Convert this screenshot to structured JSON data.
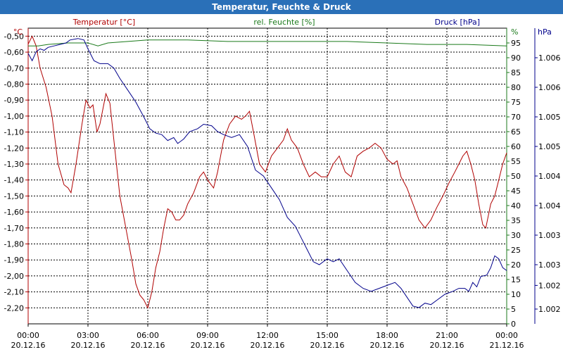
{
  "window": {
    "title": "Temperatur, Feuchte & Druck"
  },
  "chart_data": {
    "type": "line",
    "title": "Temperatur, Feuchte & Druck",
    "grid": true,
    "x": {
      "range_hours": [
        0,
        24
      ],
      "ticks_hours": [
        0,
        3,
        6,
        9,
        12,
        15,
        18,
        21,
        24
      ],
      "time_labels": [
        "00:00",
        "03:00",
        "06:00",
        "09:00",
        "12:00",
        "15:00",
        "18:00",
        "21:00",
        "00:00"
      ],
      "date_labels": [
        "20.12.16",
        "20.12.16",
        "20.12.16",
        "20.12.16",
        "20.12.16",
        "20.12.16",
        "20.12.16",
        "20.12.16",
        "21.12.16"
      ]
    },
    "y_left": {
      "unit_label": "°C",
      "range": [
        -2.3,
        -0.45
      ],
      "ticks": [
        -0.5,
        -0.6,
        -0.7,
        -0.8,
        -0.9,
        -1.0,
        -1.1,
        -1.2,
        -1.3,
        -1.4,
        -1.5,
        -1.6,
        -1.7,
        -1.8,
        -1.9,
        -2.0,
        -2.1,
        -2.2
      ],
      "tick_labels": [
        "-0,50",
        "-0,60",
        "-0,70",
        "-0,80",
        "-0,90",
        "-1,00",
        "-1,10",
        "-1,20",
        "-1,30",
        "-1,40",
        "-1,50",
        "-1,60",
        "-1,70",
        "-1,80",
        "-1,90",
        "-2,00",
        "-2,10",
        "-2,20"
      ]
    },
    "y_mid": {
      "unit_label": "%",
      "range": [
        0,
        100
      ],
      "ticks": [
        0,
        5,
        10,
        15,
        20,
        25,
        30,
        35,
        40,
        45,
        50,
        55,
        60,
        65,
        70,
        75,
        80,
        85,
        90,
        95
      ],
      "tick_labels": [
        "0",
        "5",
        "10",
        "15",
        "20",
        "25",
        "30",
        "35",
        "40",
        "45",
        "50",
        "55",
        "60",
        "65",
        "70",
        "75",
        "80",
        "85",
        "90",
        "95"
      ]
    },
    "y_right": {
      "unit_label": "hPa",
      "tick_labels": [
        "1.006",
        "1.006",
        "1.005",
        "1.005",
        "1.004",
        "1.004",
        "1.003",
        "1.003",
        "1.002",
        "1.002"
      ],
      "tick_humidity_equiv": [
        90,
        80,
        70,
        60,
        50,
        40,
        30,
        20,
        13,
        5
      ]
    },
    "series": [
      {
        "name": "Temperatur [°C]",
        "color": "#b00000",
        "axis": "left",
        "points": [
          [
            0.0,
            -0.55
          ],
          [
            0.2,
            -0.5
          ],
          [
            0.4,
            -0.56
          ],
          [
            0.6,
            -0.7
          ],
          [
            0.9,
            -0.82
          ],
          [
            1.2,
            -1.0
          ],
          [
            1.5,
            -1.3
          ],
          [
            1.8,
            -1.43
          ],
          [
            2.0,
            -1.45
          ],
          [
            2.15,
            -1.48
          ],
          [
            2.4,
            -1.3
          ],
          [
            2.7,
            -1.05
          ],
          [
            2.9,
            -0.9
          ],
          [
            3.1,
            -0.95
          ],
          [
            3.25,
            -0.93
          ],
          [
            3.45,
            -1.1
          ],
          [
            3.6,
            -1.05
          ],
          [
            3.9,
            -0.86
          ],
          [
            4.1,
            -0.92
          ],
          [
            4.3,
            -1.15
          ],
          [
            4.6,
            -1.5
          ],
          [
            4.9,
            -1.7
          ],
          [
            5.2,
            -1.9
          ],
          [
            5.4,
            -2.05
          ],
          [
            5.6,
            -2.12
          ],
          [
            5.8,
            -2.15
          ],
          [
            6.0,
            -2.2
          ],
          [
            6.2,
            -2.1
          ],
          [
            6.4,
            -1.95
          ],
          [
            6.6,
            -1.85
          ],
          [
            6.8,
            -1.7
          ],
          [
            7.0,
            -1.58
          ],
          [
            7.2,
            -1.6
          ],
          [
            7.4,
            -1.65
          ],
          [
            7.6,
            -1.65
          ],
          [
            7.8,
            -1.62
          ],
          [
            8.0,
            -1.55
          ],
          [
            8.3,
            -1.48
          ],
          [
            8.6,
            -1.38
          ],
          [
            8.8,
            -1.35
          ],
          [
            9.0,
            -1.4
          ],
          [
            9.3,
            -1.45
          ],
          [
            9.5,
            -1.35
          ],
          [
            9.8,
            -1.15
          ],
          [
            10.1,
            -1.05
          ],
          [
            10.4,
            -1.0
          ],
          [
            10.7,
            -1.02
          ],
          [
            10.9,
            -1.0
          ],
          [
            11.1,
            -0.97
          ],
          [
            11.3,
            -1.1
          ],
          [
            11.6,
            -1.3
          ],
          [
            11.9,
            -1.35
          ],
          [
            12.2,
            -1.25
          ],
          [
            12.5,
            -1.2
          ],
          [
            12.8,
            -1.15
          ],
          [
            13.0,
            -1.08
          ],
          [
            13.2,
            -1.15
          ],
          [
            13.5,
            -1.2
          ],
          [
            13.8,
            -1.3
          ],
          [
            14.1,
            -1.38
          ],
          [
            14.4,
            -1.35
          ],
          [
            14.7,
            -1.38
          ],
          [
            15.0,
            -1.38
          ],
          [
            15.3,
            -1.3
          ],
          [
            15.6,
            -1.25
          ],
          [
            15.9,
            -1.35
          ],
          [
            16.2,
            -1.38
          ],
          [
            16.5,
            -1.25
          ],
          [
            16.8,
            -1.22
          ],
          [
            17.1,
            -1.2
          ],
          [
            17.4,
            -1.17
          ],
          [
            17.7,
            -1.2
          ],
          [
            18.0,
            -1.27
          ],
          [
            18.3,
            -1.3
          ],
          [
            18.5,
            -1.28
          ],
          [
            18.7,
            -1.38
          ],
          [
            19.0,
            -1.45
          ],
          [
            19.3,
            -1.55
          ],
          [
            19.6,
            -1.65
          ],
          [
            19.9,
            -1.7
          ],
          [
            20.2,
            -1.65
          ],
          [
            20.5,
            -1.57
          ],
          [
            20.8,
            -1.5
          ],
          [
            21.1,
            -1.42
          ],
          [
            21.4,
            -1.35
          ],
          [
            21.6,
            -1.3
          ],
          [
            21.8,
            -1.25
          ],
          [
            22.0,
            -1.22
          ],
          [
            22.2,
            -1.3
          ],
          [
            22.4,
            -1.4
          ],
          [
            22.6,
            -1.55
          ],
          [
            22.8,
            -1.68
          ],
          [
            22.95,
            -1.7
          ],
          [
            23.2,
            -1.55
          ],
          [
            23.4,
            -1.5
          ],
          [
            23.6,
            -1.4
          ],
          [
            23.8,
            -1.3
          ],
          [
            24.0,
            -1.23
          ]
        ]
      },
      {
        "name": "rel. Feuchte [%]",
        "color": "#1b7a1b",
        "axis": "mid",
        "points": [
          [
            0.0,
            94.0
          ],
          [
            0.5,
            94.0
          ],
          [
            1.0,
            94.5
          ],
          [
            2.0,
            95.0
          ],
          [
            3.0,
            95.0
          ],
          [
            3.5,
            94.0
          ],
          [
            4.0,
            95.0
          ],
          [
            5.0,
            95.5
          ],
          [
            6.0,
            96.0
          ],
          [
            8.0,
            96.0
          ],
          [
            10.0,
            95.5
          ],
          [
            12.0,
            95.5
          ],
          [
            14.0,
            95.5
          ],
          [
            16.0,
            95.5
          ],
          [
            18.0,
            95.0
          ],
          [
            20.0,
            94.5
          ],
          [
            22.0,
            94.5
          ],
          [
            24.0,
            94.0
          ]
        ]
      },
      {
        "name": "Druck [hPa]",
        "color": "#00008b",
        "axis": "mid",
        "points": [
          [
            0.0,
            91.5
          ],
          [
            0.2,
            89.0
          ],
          [
            0.4,
            92.0
          ],
          [
            0.6,
            93.0
          ],
          [
            0.8,
            92.5
          ],
          [
            1.0,
            93.5
          ],
          [
            1.3,
            94.0
          ],
          [
            1.6,
            94.5
          ],
          [
            1.9,
            95.0
          ],
          [
            2.1,
            96.0
          ],
          [
            2.5,
            96.5
          ],
          [
            2.8,
            96.0
          ],
          [
            3.0,
            93.0
          ],
          [
            3.3,
            89.0
          ],
          [
            3.6,
            88.0
          ],
          [
            4.0,
            88.0
          ],
          [
            4.3,
            86.5
          ],
          [
            4.6,
            83.0
          ],
          [
            5.0,
            79.0
          ],
          [
            5.4,
            75.0
          ],
          [
            5.8,
            70.0
          ],
          [
            6.1,
            66.0
          ],
          [
            6.4,
            64.5
          ],
          [
            6.7,
            64.0
          ],
          [
            7.0,
            62.0
          ],
          [
            7.3,
            63.0
          ],
          [
            7.5,
            61.0
          ],
          [
            7.8,
            62.5
          ],
          [
            8.1,
            65.0
          ],
          [
            8.5,
            66.0
          ],
          [
            8.8,
            67.5
          ],
          [
            9.2,
            67.0
          ],
          [
            9.5,
            65.0
          ],
          [
            9.8,
            64.0
          ],
          [
            10.2,
            63.0
          ],
          [
            10.6,
            64.0
          ],
          [
            11.0,
            60.0
          ],
          [
            11.4,
            52.0
          ],
          [
            11.8,
            50.0
          ],
          [
            12.2,
            46.0
          ],
          [
            12.6,
            42.0
          ],
          [
            13.0,
            36.0
          ],
          [
            13.4,
            33.0
          ],
          [
            13.7,
            29.0
          ],
          [
            14.0,
            25.0
          ],
          [
            14.3,
            21.0
          ],
          [
            14.6,
            20.0
          ],
          [
            15.0,
            22.0
          ],
          [
            15.3,
            21.0
          ],
          [
            15.6,
            22.0
          ],
          [
            16.0,
            18.0
          ],
          [
            16.4,
            14.0
          ],
          [
            16.8,
            12.0
          ],
          [
            17.2,
            11.0
          ],
          [
            17.6,
            12.0
          ],
          [
            18.0,
            13.0
          ],
          [
            18.4,
            14.0
          ],
          [
            18.7,
            12.0
          ],
          [
            19.0,
            9.0
          ],
          [
            19.3,
            6.0
          ],
          [
            19.6,
            5.5
          ],
          [
            19.9,
            7.0
          ],
          [
            20.2,
            6.5
          ],
          [
            20.5,
            8.0
          ],
          [
            20.9,
            10.0
          ],
          [
            21.3,
            11.0
          ],
          [
            21.6,
            12.0
          ],
          [
            21.9,
            12.0
          ],
          [
            22.1,
            11.0
          ],
          [
            22.3,
            14.0
          ],
          [
            22.5,
            12.5
          ],
          [
            22.7,
            16.0
          ],
          [
            23.0,
            16.5
          ],
          [
            23.2,
            19.0
          ],
          [
            23.4,
            23.0
          ],
          [
            23.6,
            22.0
          ],
          [
            23.8,
            19.0
          ],
          [
            24.0,
            18.0
          ]
        ]
      }
    ]
  }
}
